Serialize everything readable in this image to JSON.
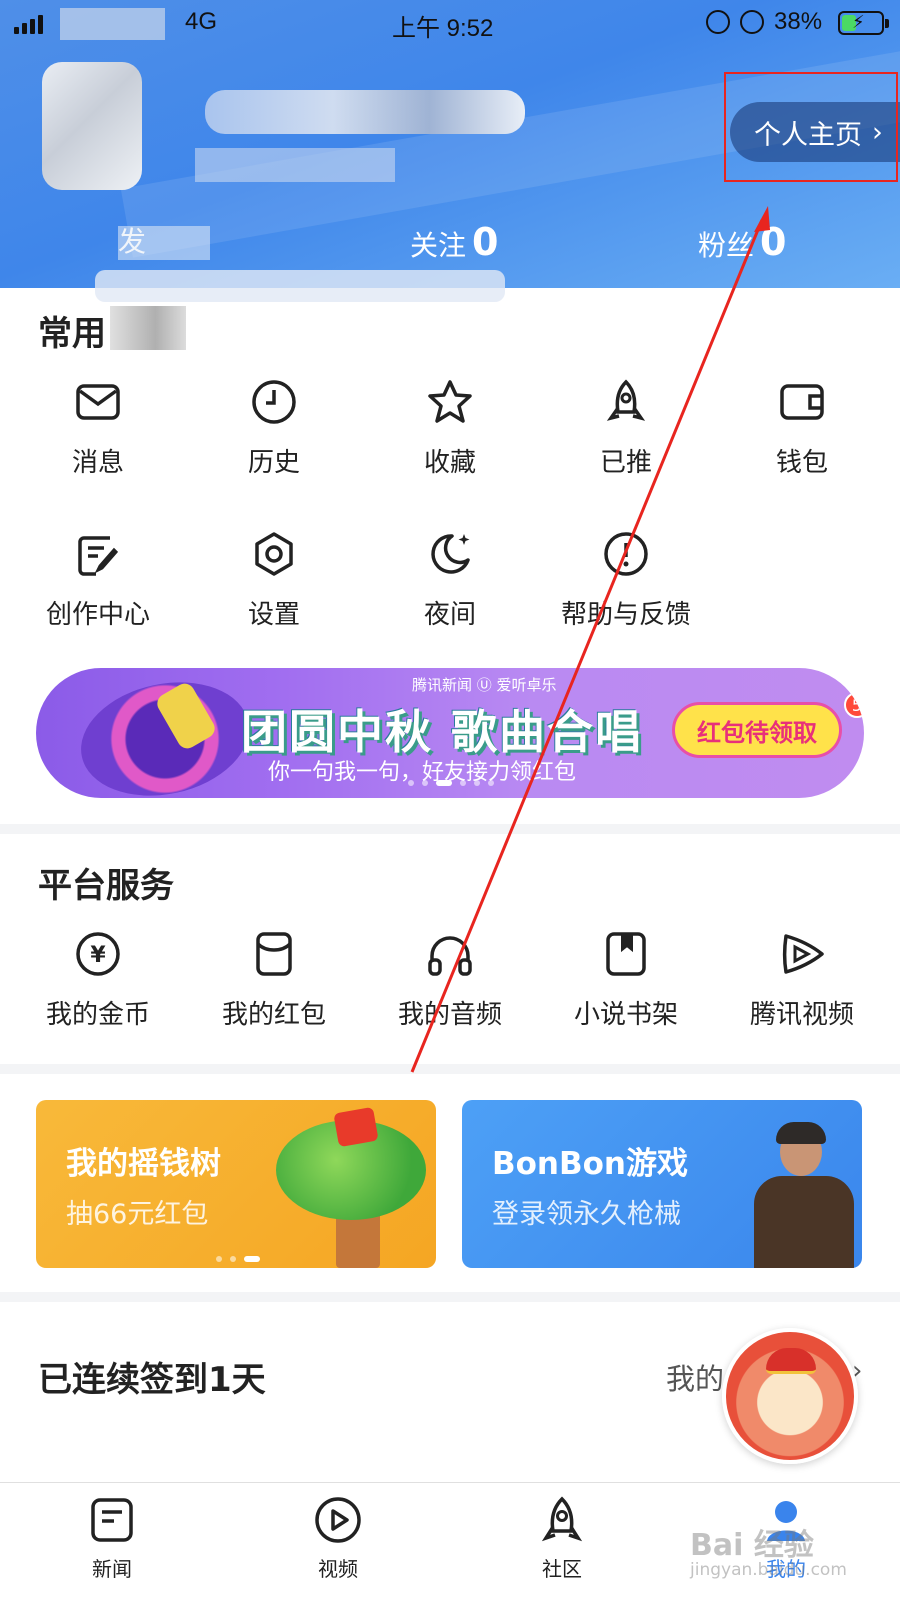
{
  "status_bar": {
    "network": "4G",
    "time": "上午 9:52",
    "battery": "38%",
    "battery_level": 0.38
  },
  "header": {
    "profile_button": "个人主页",
    "stats": {
      "follow_label": "关注",
      "follow_count": "0",
      "fans_label": "粉丝",
      "fans_count": "0",
      "posts_label": "发"
    }
  },
  "common": {
    "title": "常用",
    "items": [
      {
        "label": "消息",
        "icon": "mail-icon"
      },
      {
        "label": "历史",
        "icon": "clock-icon"
      },
      {
        "label": "收藏",
        "icon": "star-icon"
      },
      {
        "label": "已推",
        "icon": "rocket-icon"
      },
      {
        "label": "钱包",
        "icon": "wallet-icon"
      },
      {
        "label": "创作中心",
        "icon": "edit-icon"
      },
      {
        "label": "设置",
        "icon": "gear-icon"
      },
      {
        "label": "夜间",
        "icon": "moon-icon"
      },
      {
        "label": "帮助与反馈",
        "icon": "help-icon"
      }
    ]
  },
  "banner": {
    "logos": "腾讯新闻  Ⓤ 爱听卓乐",
    "headline": "团圆中秋 歌曲合唱",
    "tagline": "你一句我一句，好友接力领红包",
    "button": "红包待领取",
    "badge": "5"
  },
  "platform": {
    "title": "平台服务",
    "items": [
      {
        "label": "我的金币",
        "icon": "coin-icon"
      },
      {
        "label": "我的红包",
        "icon": "red-envelope-icon"
      },
      {
        "label": "我的音频",
        "icon": "headphones-icon"
      },
      {
        "label": "小说书架",
        "icon": "bookmark-icon"
      },
      {
        "label": "腾讯视频",
        "icon": "tencent-video-icon"
      }
    ]
  },
  "promos": [
    {
      "title": "我的摇钱树",
      "subtitle": "抽66元红包",
      "color": "#f6a623"
    },
    {
      "title": "BonBon游戏",
      "subtitle": "登录领永久枪械",
      "color": "#3f8ef0"
    }
  ],
  "signin": {
    "title": "已连续签到1天",
    "right_label": "我的"
  },
  "tabbar": [
    {
      "label": "新闻",
      "icon": "news-icon"
    },
    {
      "label": "视频",
      "icon": "video-icon"
    },
    {
      "label": "社区",
      "icon": "community-icon"
    },
    {
      "label": "我的",
      "icon": "me-icon",
      "active": true
    }
  ],
  "watermark": {
    "text": "Bai 经验",
    "url": "jingyan.baidu.com"
  },
  "colors": {
    "accent": "#3a84ec",
    "highlight": "#e8251f"
  }
}
